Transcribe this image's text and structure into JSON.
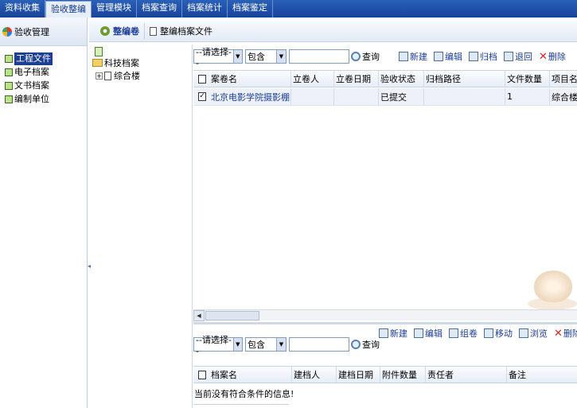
{
  "topnav": {
    "tabs": [
      "资料收集",
      "验收整编",
      "管理模块",
      "档案查询",
      "档案统计",
      "档案鉴定"
    ],
    "active_index": 1
  },
  "sidebar": {
    "title": "验收管理",
    "items": [
      {
        "label": "工程文件",
        "active": true
      },
      {
        "label": "电子档案",
        "active": false
      },
      {
        "label": "文书档案",
        "active": false
      },
      {
        "label": "编制单位",
        "active": false
      }
    ]
  },
  "subbar": {
    "item1": "整编卷",
    "item2": "整编档案文件"
  },
  "tree": {
    "root": "科技档案",
    "child": "综合楼"
  },
  "top_search": {
    "select1": "--请选择--",
    "select2": "包含",
    "query": "查询",
    "buttons": [
      "新建",
      "编辑",
      "归档",
      "退回",
      "删除"
    ]
  },
  "top_grid": {
    "headers": [
      "案卷名",
      "立卷人",
      "立卷日期",
      "验收状态",
      "归档路径",
      "文件数量",
      "项目名"
    ],
    "rows": [
      [
        "北京电影学院摄影棚...",
        "",
        "",
        "已提交",
        "",
        "1",
        "综合楼"
      ]
    ]
  },
  "bottom_search": {
    "select1": "--请选择--",
    "select2": "包含",
    "query": "查询",
    "buttons": [
      "新建",
      "编辑",
      "组卷",
      "移动",
      "浏览",
      "删除"
    ]
  },
  "bottom_grid": {
    "headers": [
      "档案名",
      "建档人",
      "建档日期",
      "附件数量",
      "责任者",
      "备注"
    ],
    "empty_message": "当前没有符合条件的信息!"
  }
}
